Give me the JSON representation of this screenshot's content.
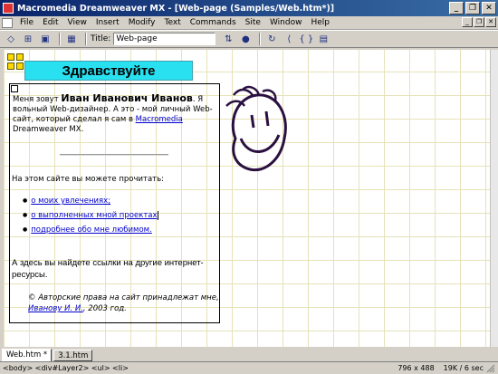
{
  "window": {
    "title": "Macromedia Dreamweaver MX - [Web-page (Samples/Web.htm*)]",
    "buttons": [
      "_",
      "❐",
      "✕"
    ]
  },
  "menu": {
    "items": [
      "File",
      "Edit",
      "View",
      "Insert",
      "Modify",
      "Text",
      "Commands",
      "Site",
      "Window",
      "Help"
    ]
  },
  "toolbar": {
    "title_label": "Title:",
    "title_value": "Web-page",
    "code_label": "{ }"
  },
  "page": {
    "heading": "Здравствуйте",
    "intro_prefix": "Меня зовут ",
    "intro_name": "Иван Иванович Иванов",
    "intro_mid": ". Я вольный Web-дизайнер. А это - мой личный Web-сайт, который сделал я сам в ",
    "intro_link": "Macromedia",
    "intro_suffix": " Dreamweaver MX.",
    "read_heading": "На этом сайте вы можете прочитать:",
    "links": [
      "о моих увлечениях;",
      "о выполненных мной проектах",
      "подробнее обо мне любимом."
    ],
    "note": "А здесь вы найдете ссылки на другие интернет-ресурсы.",
    "copyright_prefix": "© Авторские права на сайт принадлежат мне, ",
    "copyright_link": "Иванову И. И.",
    "copyright_suffix": ", 2003 год."
  },
  "tabs": [
    "Web.htm *",
    "3.1.htm"
  ],
  "status": {
    "tags": "<body> <div#Layer2> <ul> <li>",
    "size": "796 x 488",
    "download": "19K / 6 sec"
  }
}
